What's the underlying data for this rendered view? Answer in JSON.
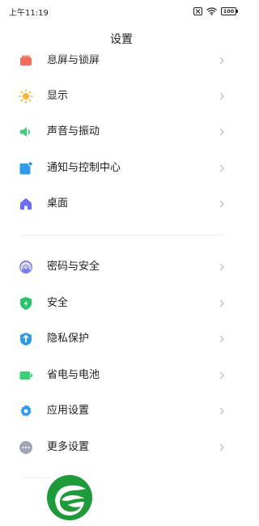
{
  "status_bar": {
    "time": "上午11:19",
    "battery": "100",
    "icons": [
      "sim-off-icon",
      "wifi-icon",
      "battery-icon"
    ]
  },
  "header": {
    "title": "设置"
  },
  "sections": [
    {
      "items": [
        {
          "label": "息屏与锁屏",
          "icon": "lock-screen-icon",
          "color": "#f26b5b"
        },
        {
          "label": "显示",
          "icon": "sun-icon",
          "color": "#f7b531"
        },
        {
          "label": "声音与振动",
          "icon": "speaker-icon",
          "color": "#3fce78"
        },
        {
          "label": "通知与控制中心",
          "icon": "notification-icon",
          "color": "#2f9be8"
        },
        {
          "label": "桌面",
          "icon": "home-icon",
          "color": "#6c6cf0"
        }
      ]
    },
    {
      "items": [
        {
          "label": "密码与安全",
          "icon": "fingerprint-icon",
          "color": "#7b7fe8"
        },
        {
          "label": "安全",
          "icon": "shield-icon",
          "color": "#2cc26a"
        },
        {
          "label": "隐私保护",
          "icon": "privacy-icon",
          "color": "#2f9be8"
        },
        {
          "label": "省电与电池",
          "icon": "battery-saver-icon",
          "color": "#3fce78"
        },
        {
          "label": "应用设置",
          "icon": "gear-icon",
          "color": "#2f9be8"
        },
        {
          "label": "更多设置",
          "icon": "more-icon",
          "color": "#a3a6b8"
        }
      ]
    }
  ],
  "watermark": {
    "icon": "leaf-logo-icon",
    "color": "#1e9a3a"
  }
}
